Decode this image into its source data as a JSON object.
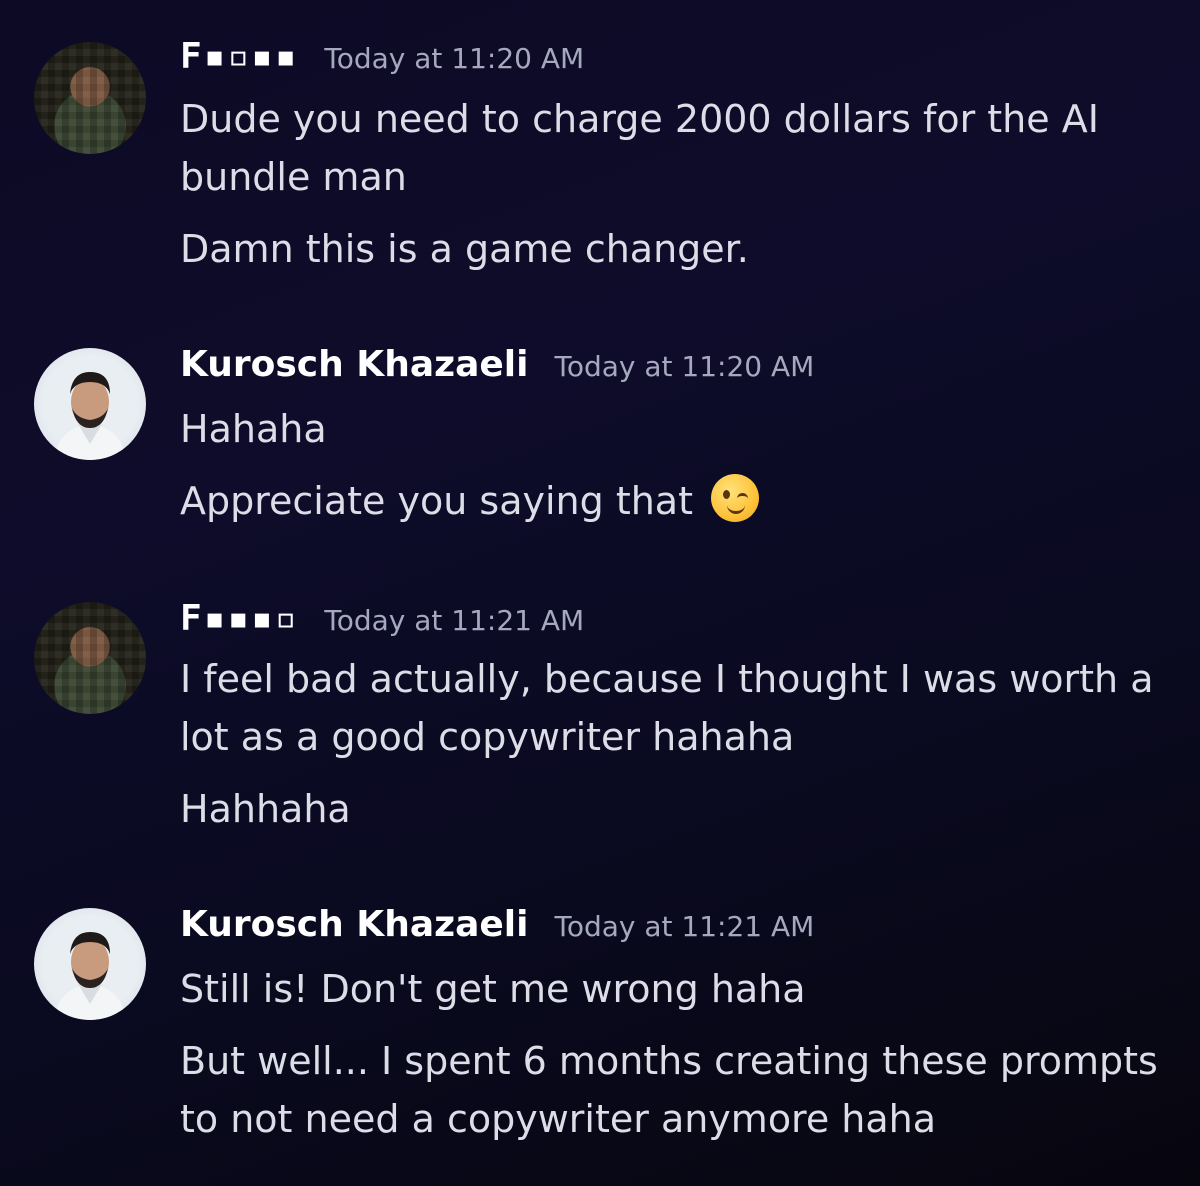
{
  "messages": [
    {
      "username": "F▪▫▪▪",
      "timestamp": "Today at 11:20 AM",
      "lines": [
        "Dude you need to charge 2000 dollars for the AI",
        "bundle man",
        "Damn this is a game changer."
      ]
    },
    {
      "username": "Kurosch Khazaeli",
      "timestamp": "Today at 11:20 AM",
      "lines": [
        "Hahaha",
        "Appreciate you saying that"
      ],
      "emoji": "winking-face"
    },
    {
      "username": "F▪▪▪▫",
      "timestamp": "Today at 11:21 AM",
      "lines": [
        "I feel bad actually, because I thought I was worth a",
        "lot as a good copywriter hahaha",
        "Hahhaha"
      ]
    },
    {
      "username": "Kurosch Khazaeli",
      "timestamp": "Today at 11:21 AM",
      "lines": [
        "Still is! Don't get me wrong haha",
        "But well... I spent 6 months creating these prompts",
        "to not need a copywriter anymore haha"
      ]
    }
  ]
}
